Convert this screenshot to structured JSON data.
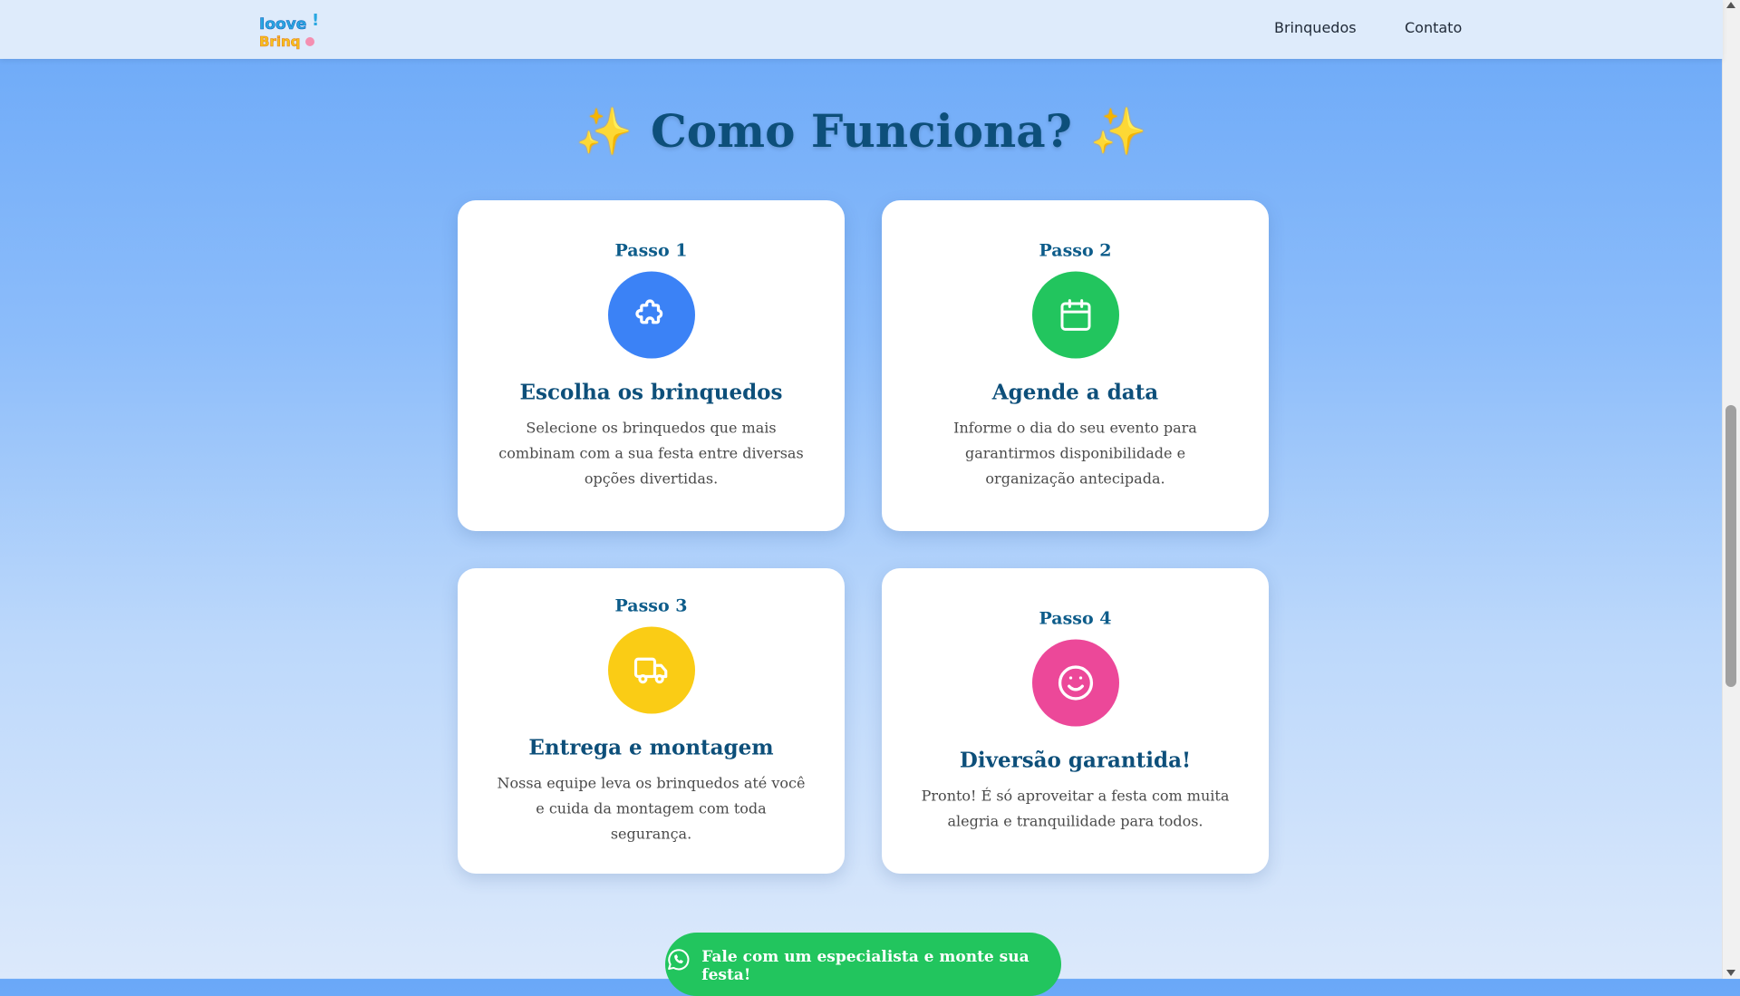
{
  "header": {
    "logo_alt": "Ioove Brinq",
    "nav": [
      {
        "label": "Brinquedos"
      },
      {
        "label": "Contato"
      }
    ]
  },
  "section": {
    "title": "Como Funciona?",
    "title_emoji": "✨",
    "steps": [
      {
        "step": "Passo 1",
        "icon": "puzzle-icon",
        "color": "#3b82f6",
        "title": "Escolha os brinquedos",
        "text": "Selecione os brinquedos que mais combinam com a sua festa entre diversas opções divertidas."
      },
      {
        "step": "Passo 2",
        "icon": "calendar-icon",
        "color": "#22c55e",
        "title": "Agende a data",
        "text": "Informe o dia do seu evento para garantirmos disponibilidade e organização antecipada."
      },
      {
        "step": "Passo 3",
        "icon": "truck-icon",
        "color": "#facc15",
        "title": "Entrega e montagem",
        "text": "Nossa equipe leva os brinquedos até você e cuida da montagem com toda segurança."
      },
      {
        "step": "Passo 4",
        "icon": "smile-icon",
        "color": "#ec4899",
        "title": "Diversão garantida!",
        "text": "Pronto! É só aproveitar a festa com muita alegria e tranquilidade para todos."
      }
    ]
  },
  "cta": {
    "label": "Fale com um especialista e monte sua festa!",
    "icon": "whatsapp-icon",
    "color": "#22c55e"
  }
}
